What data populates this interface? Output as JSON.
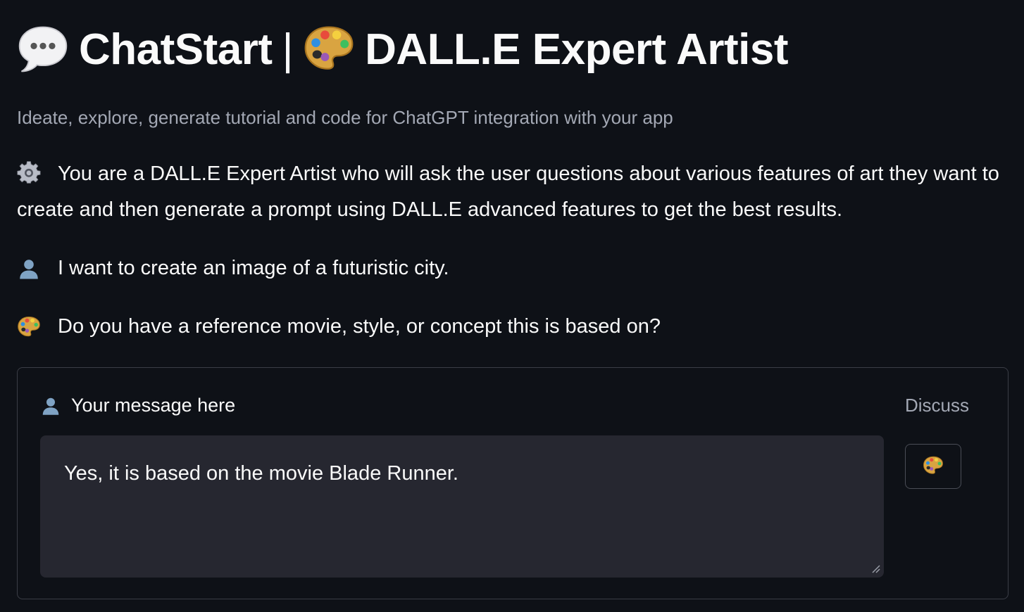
{
  "header": {
    "app_name": "ChatStart",
    "separator": "|",
    "persona_title": "DALL.E Expert Artist",
    "speech_icon": "speech-bubble-icon",
    "persona_icon": "artist-palette-icon",
    "subtitle": "Ideate, explore, generate tutorial and code for ChatGPT integration with your app"
  },
  "conversation": [
    {
      "role": "system",
      "icon": "gear-icon",
      "text": "You are a DALL.E Expert Artist who will ask the user questions about various features of art they want to create and then generate a prompt using DALL.E advanced features to get the best results."
    },
    {
      "role": "user",
      "icon": "user-silhouette-icon",
      "text": "I want to create an image of a futuristic city."
    },
    {
      "role": "assistant",
      "icon": "artist-palette-icon",
      "text": "Do you have a reference movie, style, or concept this is based on?"
    }
  ],
  "input_form": {
    "label": "Your message here",
    "label_icon": "user-silhouette-icon",
    "value": "Yes, it is based on the movie Blade Runner.",
    "discuss_label": "Discuss",
    "submit_icon": "artist-palette-icon"
  },
  "colors": {
    "background": "#0e1117",
    "text": "#fafafa",
    "muted_text": "#a3a8b4",
    "input_background": "#262730",
    "border": "#3a3d46"
  }
}
